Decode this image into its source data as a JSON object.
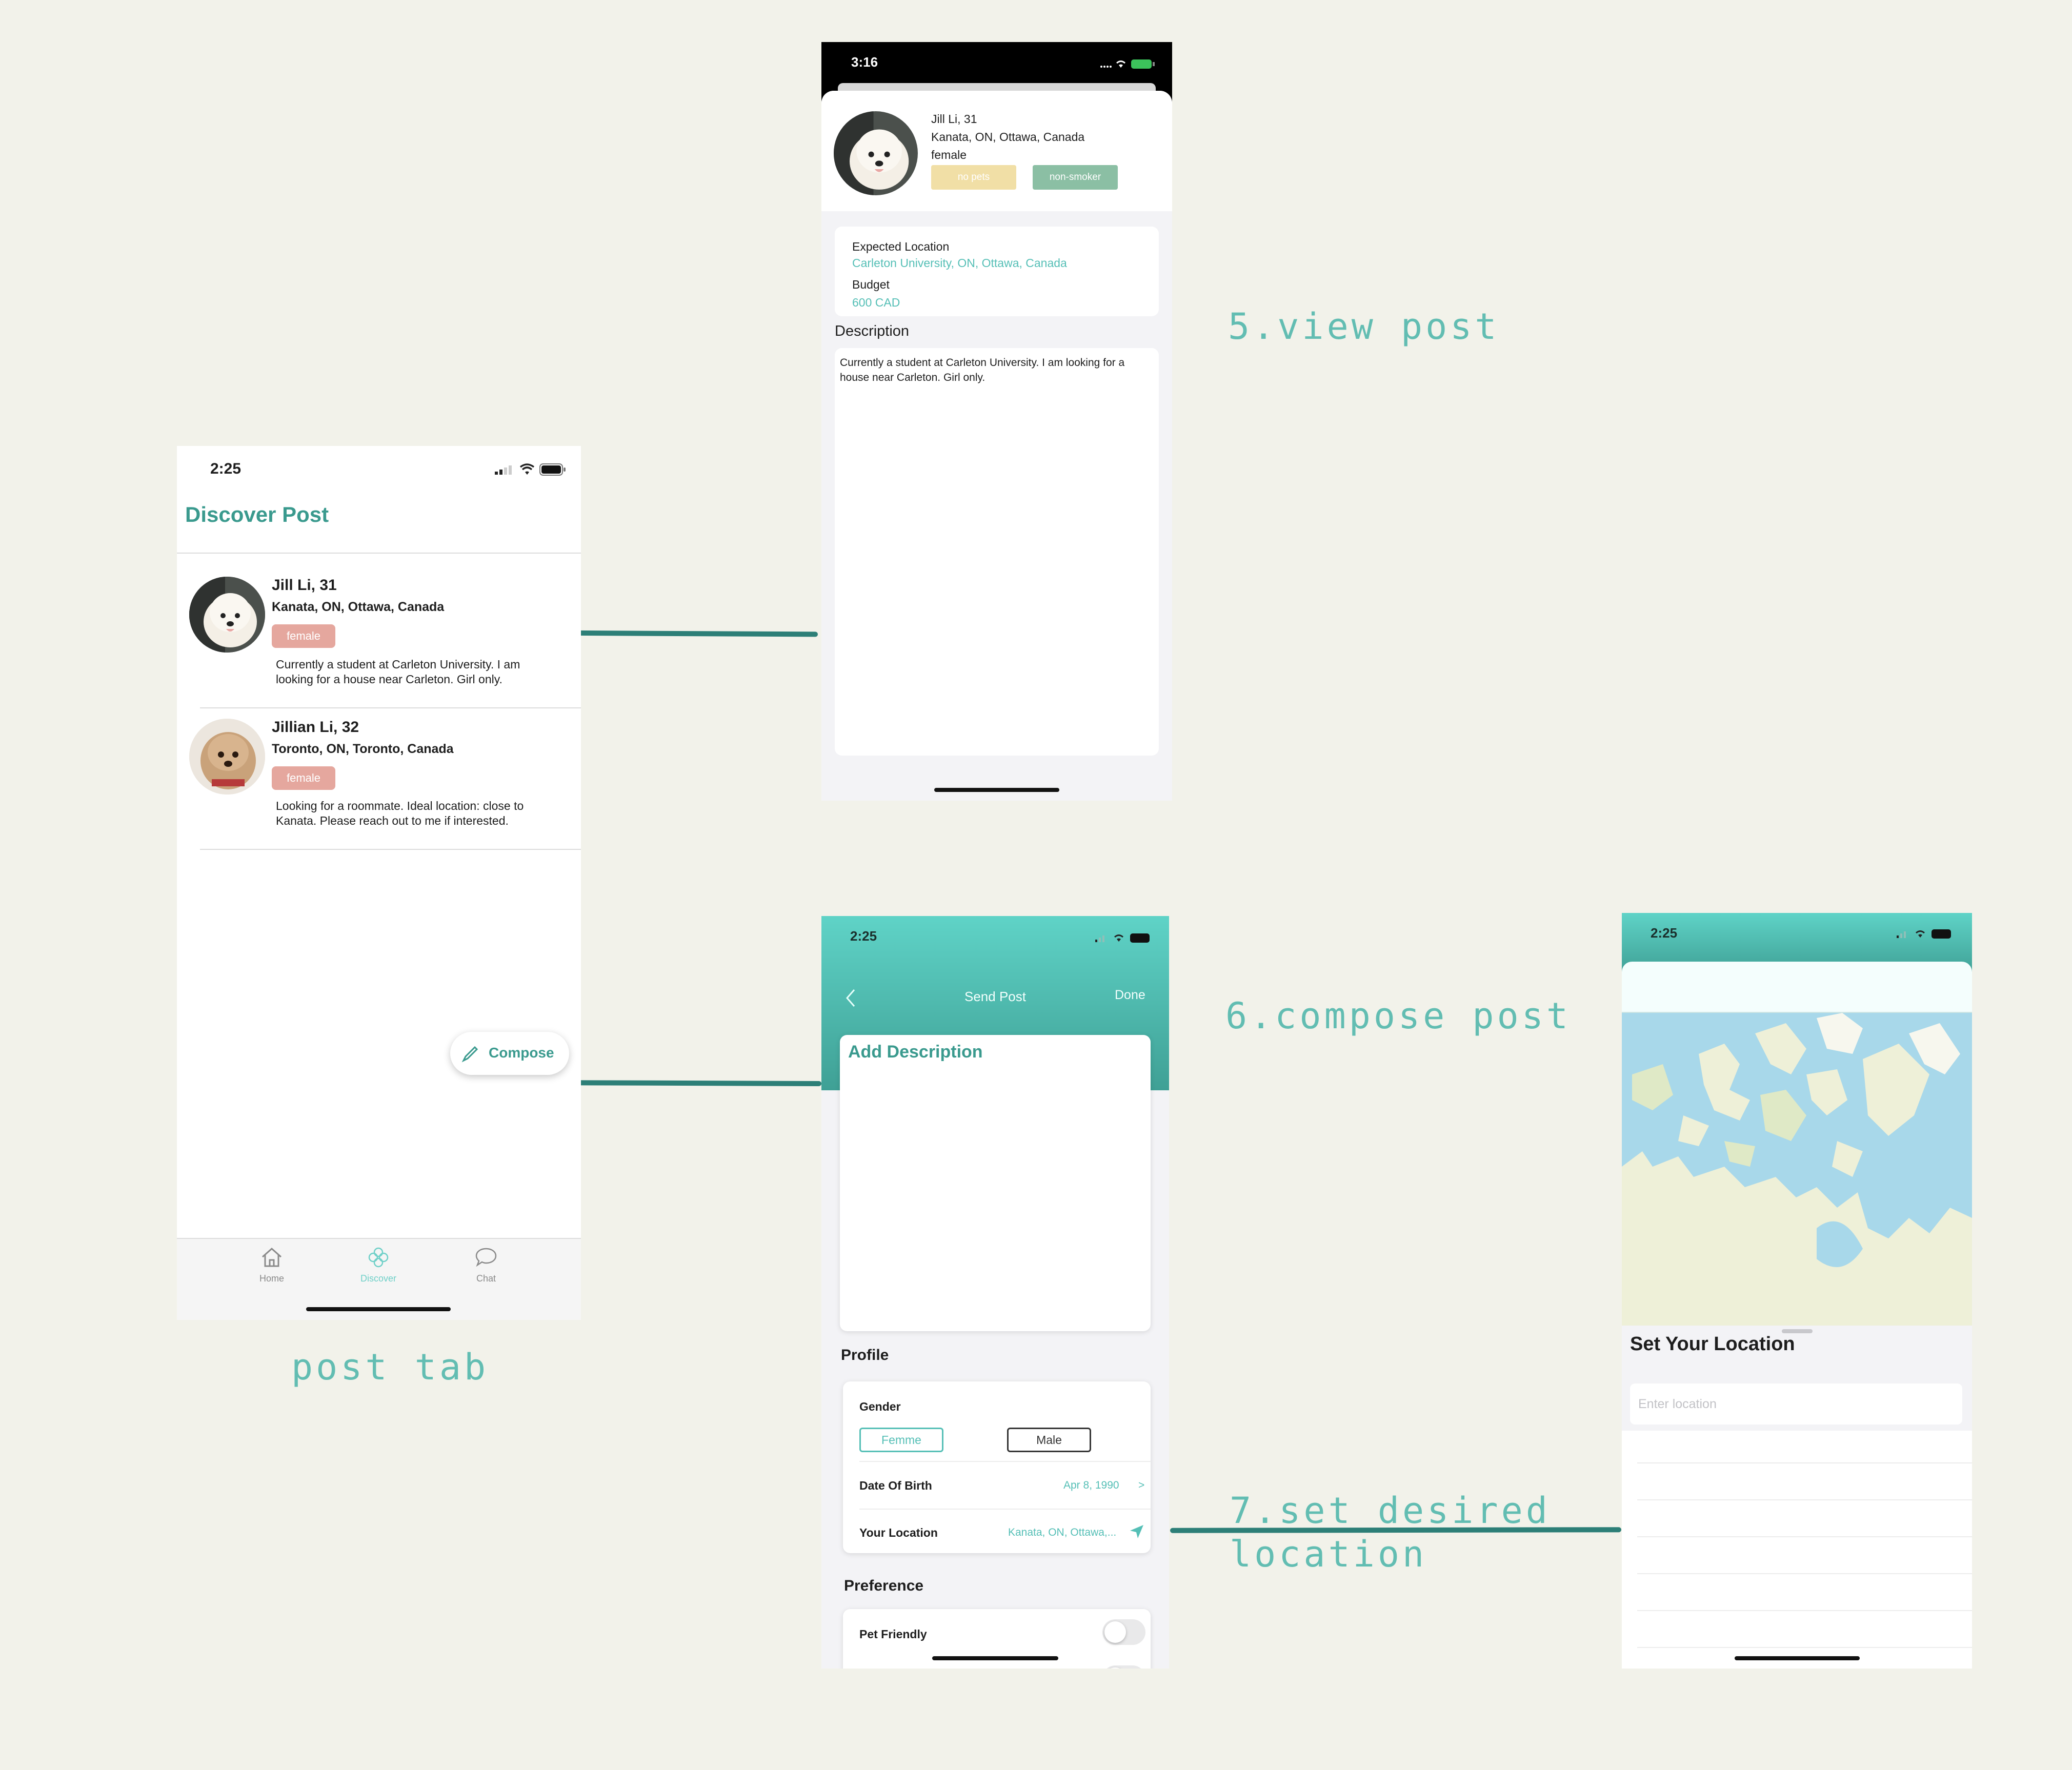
{
  "captions": {
    "view_post": "5.view post",
    "compose_post": "6.compose post",
    "set_location_line1": "7.set desired",
    "set_location_line2": "location",
    "post_tab": "post tab"
  },
  "post_tab": {
    "time": "2:25",
    "title": "Discover Post",
    "posts": [
      {
        "name": "Jill Li, 31",
        "location": "Kanata, ON, Ottawa, Canada",
        "gender": "female",
        "description": "Currently a student at Carleton University. I am looking for a house near Carleton. Girl only."
      },
      {
        "name": "Jillian Li, 32",
        "location": "Toronto, ON, Toronto, Canada",
        "gender": "female",
        "description": "Looking for a roommate. Ideal location: close to Kanata. Please reach out to me if interested."
      }
    ],
    "compose_label": "Compose",
    "tabs": [
      {
        "label": "Home",
        "icon": "house-icon"
      },
      {
        "label": "Discover",
        "icon": "flower-icon"
      },
      {
        "label": "Chat",
        "icon": "chat-bubble-icon"
      }
    ]
  },
  "view_post": {
    "time": "3:16",
    "name": "Jill Li, 31",
    "location": "Kanata, ON, Ottawa, Canada",
    "gender": "female",
    "tags": [
      "no pets",
      "non-smoker"
    ],
    "expected_location_label": "Expected Location",
    "expected_location": "Carleton University, ON, Ottawa, Canada",
    "budget_label": "Budget",
    "budget": "600 CAD",
    "description_label": "Description",
    "description": "Currently a student at Carleton University. I am looking for a house near Carleton. Girl only."
  },
  "compose": {
    "time": "2:25",
    "nav_title": "Send Post",
    "done_label": "Done",
    "add_description": "Add Description",
    "profile_label": "Profile",
    "gender_label": "Gender",
    "gender_options": [
      "Femme",
      "Male"
    ],
    "dob_label": "Date Of Birth",
    "dob_value": "Apr 8, 1990",
    "location_label": "Your Location",
    "location_value": "Kanata, ON, Ottawa,...",
    "preference_label": "Preference",
    "pet_friendly_label": "Pet Friendly",
    "pet_friendly_on": false
  },
  "set_location": {
    "time": "2:25",
    "title": "Set Your Location",
    "placeholder": "Enter location"
  },
  "colors": {
    "teal": "#3a9a8e",
    "teal_light": "#55bfb6",
    "female_tag": "#e5a79e",
    "no_pets_tag": "#f1dfa6",
    "non_smoker_tag": "#8bbfa4"
  }
}
